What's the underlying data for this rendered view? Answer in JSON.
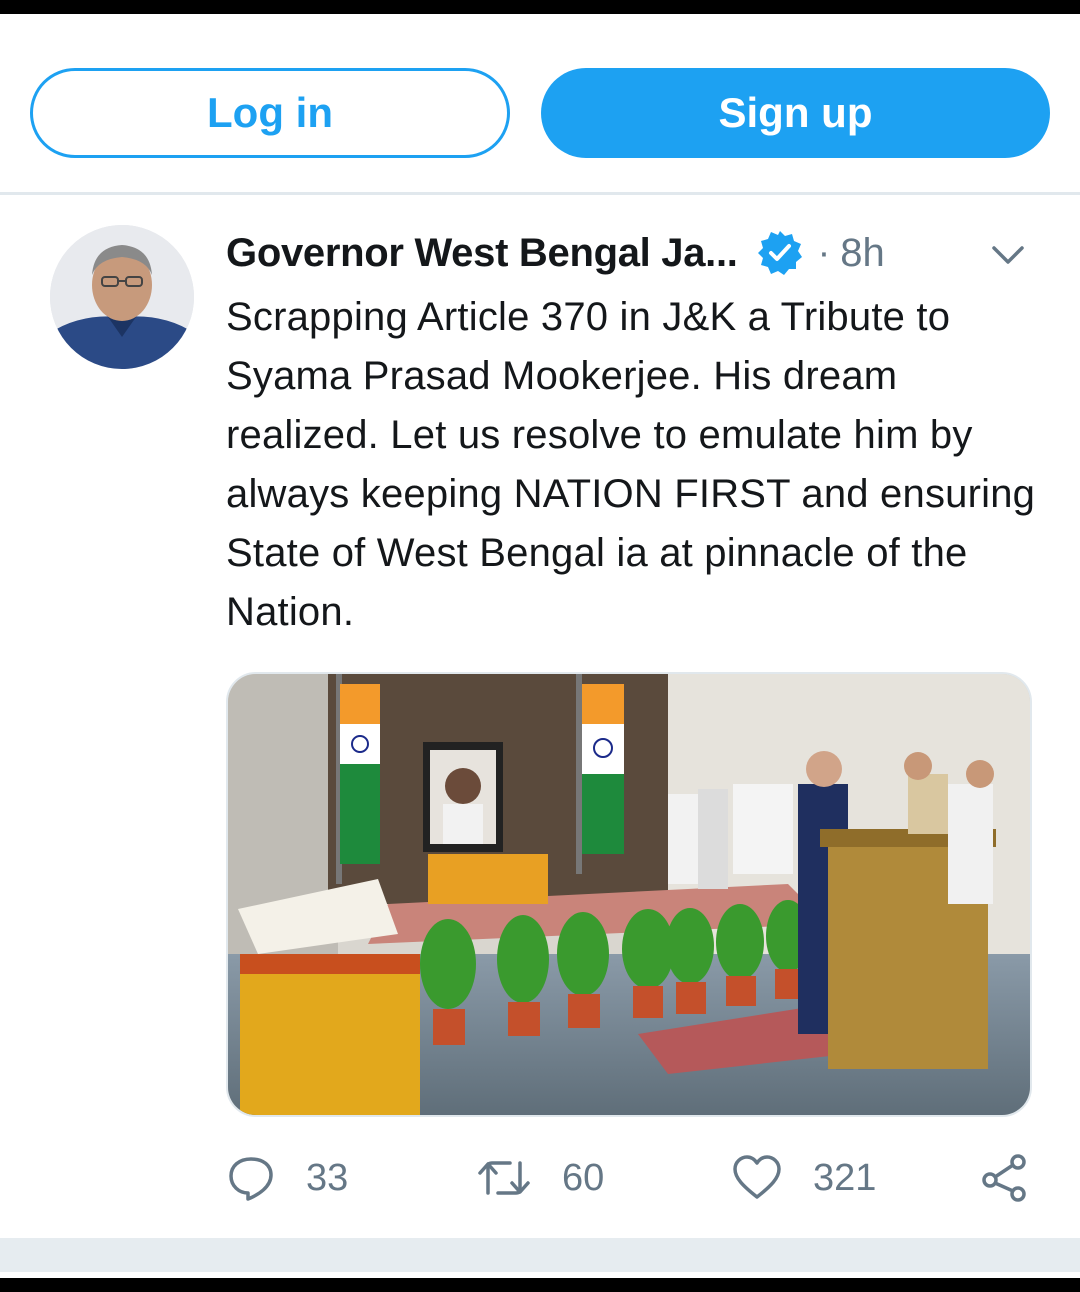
{
  "auth": {
    "login_label": "Log in",
    "signup_label": "Sign up"
  },
  "tweet": {
    "author_name": "Governor West Bengal Ja...",
    "separator": "·",
    "time": "8h",
    "text": "Scrapping Article 370 in J&K a Tribute to Syama Prasad Mookerjee. His dream realized. Let us resolve to emulate him by always keeping NATION FIRST and ensuring State of West Bengal ia at pinnacle of the Nation."
  },
  "actions": {
    "replies": "33",
    "retweets": "60",
    "likes": "321"
  },
  "icons": {
    "verified": "verified-badge-icon",
    "chevron": "chevron-down-icon",
    "reply": "reply-icon",
    "retweet": "retweet-icon",
    "like": "heart-icon",
    "share": "share-icon"
  },
  "colors": {
    "accent": "#1da1f2",
    "muted": "#657786",
    "text": "#14171a"
  }
}
